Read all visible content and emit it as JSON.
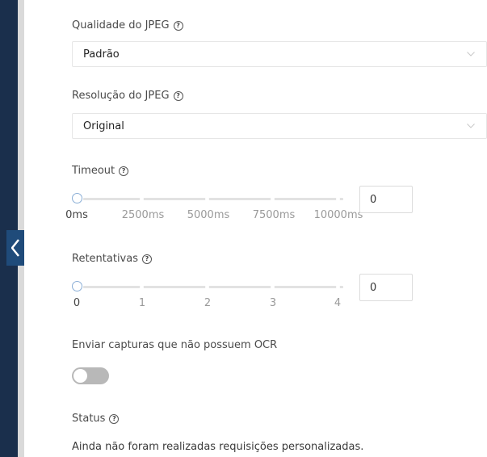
{
  "colors": {
    "sidebar_dark": "#1a2f4c",
    "sidebar_gray": "#dadada",
    "collapse_tab": "#1f4b7a",
    "slider_handle": "#8aaed6",
    "toggle_off": "#b8b8b8"
  },
  "icons": {
    "help": "help-circle-icon",
    "dropdown": "chevron-down-icon",
    "collapse": "chevron-left-icon"
  },
  "jpeg_quality": {
    "label": "Qualidade do JPEG",
    "help_glyph": "?",
    "value": "Padrão"
  },
  "jpeg_resolution": {
    "label": "Resolução do JPEG",
    "help_glyph": "?",
    "value": "Original"
  },
  "timeout": {
    "label": "Timeout",
    "help_glyph": "?",
    "ticks": [
      "0ms",
      "2500ms",
      "5000ms",
      "7500ms",
      "10000ms"
    ],
    "value": "0",
    "slider_fraction": 0
  },
  "retries": {
    "label": "Retentativas",
    "help_glyph": "?",
    "ticks": [
      "0",
      "1",
      "2",
      "3",
      "4"
    ],
    "value": "0",
    "slider_fraction": 0
  },
  "send_without_ocr": {
    "label": "Enviar capturas que não possuem OCR",
    "enabled": false
  },
  "status": {
    "label": "Status",
    "help_glyph": "?",
    "message": "Ainda não foram realizadas requisições personalizadas."
  }
}
